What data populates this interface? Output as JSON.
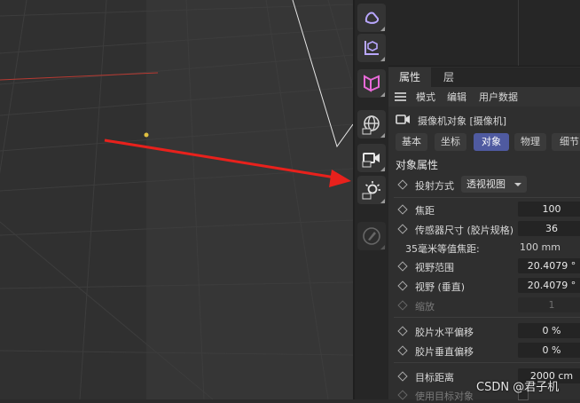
{
  "colors": {
    "accent": "#4f5aa0",
    "arrow": "#e8211c",
    "axis_x": "#c0392b"
  },
  "toolbar_icons": [
    "curve-tool-icon",
    "axis-cube-icon",
    "bend-deformer-icon",
    "sky-globe-icon",
    "camera-icon",
    "light-icon",
    "paint-icon"
  ],
  "attributes_panel": {
    "tabs": [
      "属性",
      "层"
    ],
    "menu": [
      "模式",
      "编辑",
      "用户数据"
    ],
    "object_title": "摄像机对象 [摄像机]",
    "subtabs": [
      "基本",
      "坐标",
      "对象",
      "物理",
      "细节"
    ],
    "active_subtab": "对象",
    "section_title": "对象属性",
    "projection": {
      "label": "投射方式",
      "value": "透视视图"
    },
    "properties": [
      {
        "label": "焦距",
        "value": "100"
      },
      {
        "label": "传感器尺寸 (胶片规格)",
        "value": "36"
      },
      {
        "label": "35毫米等值焦距:",
        "value": "100 mm"
      },
      {
        "label": "视野范围",
        "value": "20.4079 °"
      },
      {
        "label": "视野 (垂直)",
        "value": "20.4079 °"
      },
      {
        "label": "缩放",
        "value": "1"
      },
      {
        "label": "胶片水平偏移",
        "value": "0 %"
      },
      {
        "label": "胶片垂直偏移",
        "value": "0 %"
      },
      {
        "label": "目标距离",
        "value": "2000 cm"
      },
      {
        "label": "使用目标对象",
        "value": ""
      }
    ]
  },
  "watermark": "CSDN @君子机"
}
